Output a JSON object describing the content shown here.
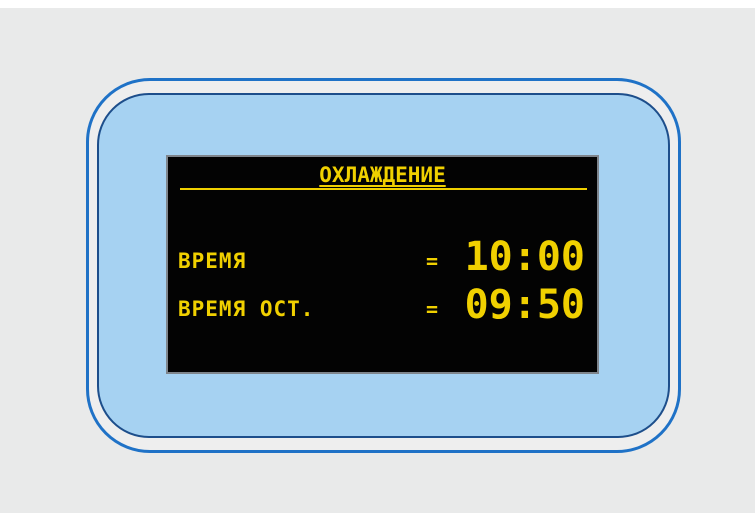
{
  "display": {
    "title": "ОХЛАЖДЕНИЕ",
    "rows": [
      {
        "label": "ВРЕМЯ",
        "separator": "=",
        "value": "10:00"
      },
      {
        "label": "ВРЕМЯ ОСТ.",
        "separator": "=",
        "value": "09:50"
      }
    ]
  },
  "colors": {
    "text": "#f0d000",
    "screen_background": "#030303",
    "panel_background": "#a6d2f2",
    "frame_border": "#1f72c7",
    "inner_border": "#1d4e8b"
  }
}
